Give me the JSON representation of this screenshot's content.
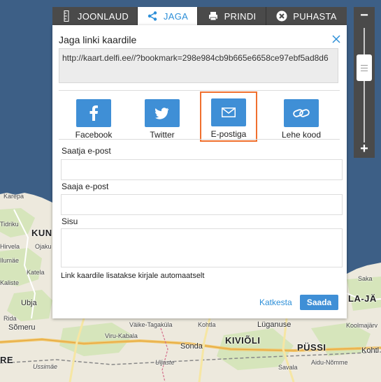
{
  "tabs": [
    {
      "label": "JOONLAUD",
      "icon": "ruler-icon"
    },
    {
      "label": "JAGA",
      "icon": "share-icon"
    },
    {
      "label": "PRINDI",
      "icon": "printer-icon"
    },
    {
      "label": "PUHASTA",
      "icon": "clear-icon"
    }
  ],
  "dialog": {
    "title": "Jaga linki kaardile",
    "url": "http://kaart.delfi.ee//?bookmark=298e984cb9b665e6658ce97ebf5ad8d6",
    "share_options": [
      {
        "label": "Facebook",
        "icon": "facebook-icon"
      },
      {
        "label": "Twitter",
        "icon": "twitter-icon"
      },
      {
        "label": "E-postiga",
        "icon": "email-icon"
      },
      {
        "label": "Lehe kood",
        "icon": "link-icon"
      }
    ],
    "sender_label": "Saatja e-post",
    "sender_value": "",
    "recipient_label": "Saaja e-post",
    "recipient_value": "",
    "content_label": "Sisu",
    "content_value": "",
    "note": "Link kaardile lisatakse kirjale automaatselt",
    "cancel_label": "Katkesta",
    "send_label": "Saada"
  },
  "zoom": {
    "plus": "+",
    "minus": "−"
  },
  "map_labels": {
    "karepa": "Karepa",
    "tidriku": "Tidriku",
    "kunda": "KUN",
    "ojaku": "Ojaku",
    "hirvela": "Hirvela",
    "ilumae": "Ilumäe",
    "katela": "Katela",
    "kaliste": "Kaliste",
    "ubja": "Ubja",
    "ridala": "Rida",
    "somera": "Sõmeru",
    "vaike_maarja": "RE",
    "ussimae": "Ussimäe",
    "vaike_tagakula": "Väike-Tagaküla",
    "kohtla": "Kohtla",
    "viru_kabala": "Viru-Kabala",
    "sonda": "Sonda",
    "kivioli": "KIVIÕLI",
    "puessi": "PÜSSI",
    "lugenuse": "Lüganuse",
    "uljaste": "Uljaste",
    "savala": "Savala",
    "aidu": "Aidu-Nõmme",
    "koolmajarv": "Koolmajärv",
    "saka": "Saka",
    "laja": "LA-JÄ",
    "koht": "Kohtl"
  },
  "colors": {
    "accent": "#3f8fd6",
    "active_tab_text": "#2d8fd8",
    "toolbar_bg": "#4a4a4a",
    "highlight_border": "#f0702e",
    "sea": "#3d5f86",
    "land": "#ede9dd"
  }
}
